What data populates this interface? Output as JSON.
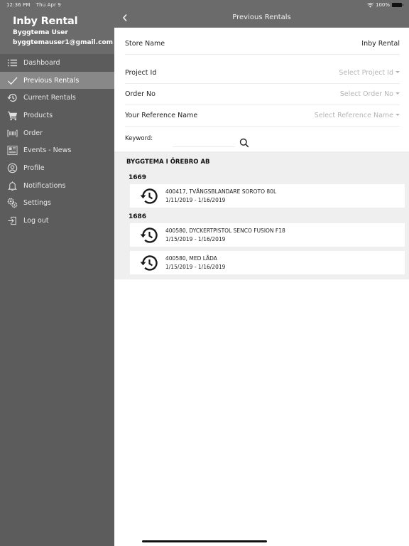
{
  "status_bar": {
    "time": "12:36 PM",
    "date": "Thu Apr 9",
    "battery": "100%"
  },
  "sidebar": {
    "app_title": "Inby Rental",
    "user_name": "Byggtema User",
    "user_email": "byggtemauser1@gmail.com",
    "items": [
      {
        "label": "Dashboard",
        "icon": "list-icon",
        "active": false
      },
      {
        "label": "Previous Rentals",
        "icon": "checkmark-icon",
        "active": true
      },
      {
        "label": "Current Rentals",
        "icon": "history-icon",
        "active": false
      },
      {
        "label": "Products",
        "icon": "cart-icon",
        "active": false
      },
      {
        "label": "Order",
        "icon": "barcode-icon",
        "active": false
      },
      {
        "label": "Events - News",
        "icon": "newspaper-icon",
        "active": false
      },
      {
        "label": "Profile",
        "icon": "profile-icon",
        "active": false
      },
      {
        "label": "Notifications",
        "icon": "bell-icon",
        "active": false
      },
      {
        "label": "Settings",
        "icon": "gears-icon",
        "active": false
      },
      {
        "label": "Log out",
        "icon": "logout-icon",
        "active": false
      }
    ]
  },
  "header": {
    "title": "Previous Rentals"
  },
  "filters": {
    "store_label": "Store Name",
    "store_value": "Inby Rental",
    "project_label": "Project Id",
    "project_placeholder": "Select Project Id",
    "order_label": "Order No",
    "order_placeholder": "Select Order No",
    "reference_label": "Your Reference Name",
    "reference_placeholder": "Select Reference Name",
    "keyword_label": "Keyword:",
    "keyword_value": ""
  },
  "results": {
    "company": "BYGGTEMA I ÖREBRO AB",
    "groups": [
      {
        "id": "1669",
        "rentals": [
          {
            "title": "400417, TVÅNGSBLANDARE SOROTO 80L",
            "dates": "1/11/2019 - 1/16/2019"
          }
        ]
      },
      {
        "id": "1686",
        "rentals": [
          {
            "title": "400580, DYCKERTPISTOL SENCO FUSION F18",
            "dates": "1/15/2019 - 1/16/2019"
          },
          {
            "title": "400580, MED LÅDA",
            "dates": "1/15/2019 - 1/16/2019"
          }
        ]
      }
    ]
  }
}
